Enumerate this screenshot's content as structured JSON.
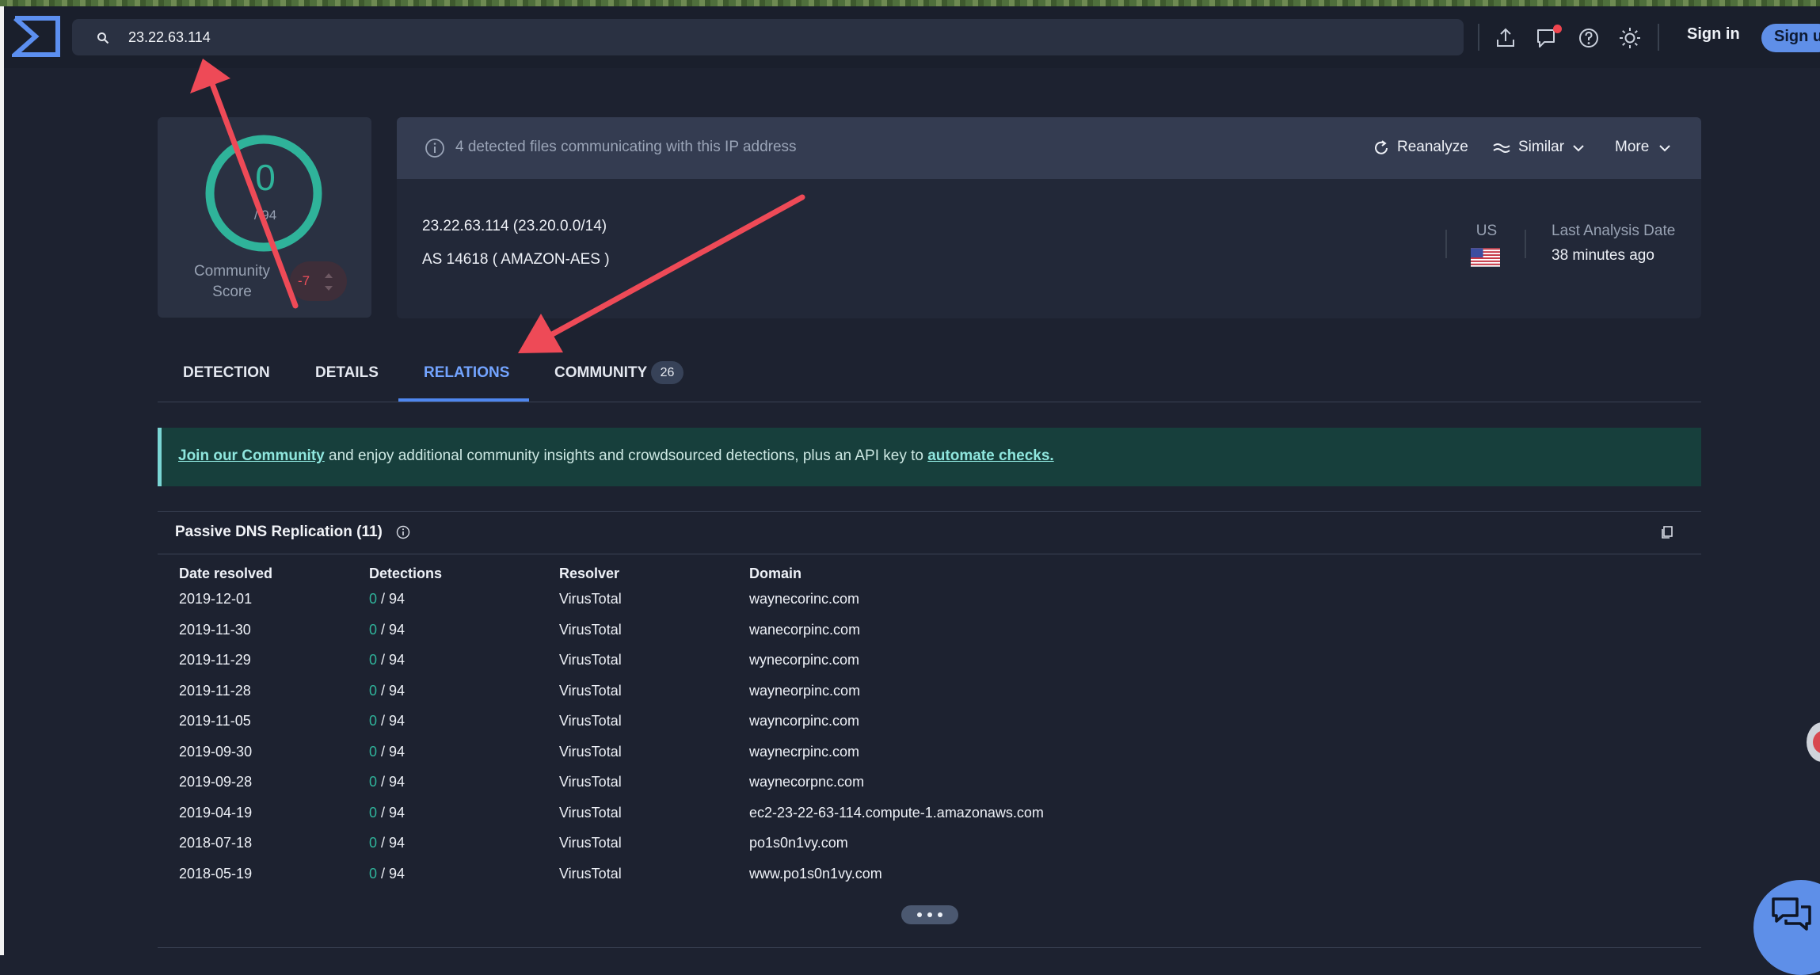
{
  "search": {
    "query": "23.22.63.114"
  },
  "header": {
    "sign_in": "Sign in",
    "sign_up": "Sign up"
  },
  "score": {
    "detections": "0",
    "total": "/ 94",
    "label": "Community Score",
    "community_vote": "-7"
  },
  "info": {
    "banner_text": "4 detected files communicating with this IP address",
    "reanalyze": "Reanalyze",
    "similar": "Similar",
    "more": "More",
    "ip_line": "23.22.63.114  (23.20.0.0/14)",
    "as_line": "AS 14618  ( AMAZON-AES )",
    "country": "US",
    "last_analysis_label": "Last Analysis Date",
    "last_analysis_value": "38 minutes ago"
  },
  "tabs": [
    {
      "label": "DETECTION"
    },
    {
      "label": "DETAILS"
    },
    {
      "label": "RELATIONS",
      "active": true
    },
    {
      "label": "COMMUNITY",
      "badge": "26"
    }
  ],
  "banner": {
    "link1": "Join our Community",
    "middle": " and enjoy additional community insights and crowdsourced detections, plus an API key to ",
    "link2": "automate checks."
  },
  "dns": {
    "title": "Passive DNS Replication  (11)",
    "columns": [
      "Date resolved",
      "Detections",
      "Resolver",
      "Domain"
    ],
    "rows": [
      {
        "date": "2019-12-01",
        "det": "0",
        "total": "/ 94",
        "resolver": "VirusTotal",
        "domain": "waynecorinc.com"
      },
      {
        "date": "2019-11-30",
        "det": "0",
        "total": "/ 94",
        "resolver": "VirusTotal",
        "domain": "wanecorpinc.com"
      },
      {
        "date": "2019-11-29",
        "det": "0",
        "total": "/ 94",
        "resolver": "VirusTotal",
        "domain": "wynecorpinc.com"
      },
      {
        "date": "2019-11-28",
        "det": "0",
        "total": "/ 94",
        "resolver": "VirusTotal",
        "domain": "wayneorpinc.com"
      },
      {
        "date": "2019-11-05",
        "det": "0",
        "total": "/ 94",
        "resolver": "VirusTotal",
        "domain": "wayncorpinc.com"
      },
      {
        "date": "2019-09-30",
        "det": "0",
        "total": "/ 94",
        "resolver": "VirusTotal",
        "domain": "waynecrpinc.com"
      },
      {
        "date": "2019-09-28",
        "det": "0",
        "total": "/ 94",
        "resolver": "VirusTotal",
        "domain": "waynecorpnc.com"
      },
      {
        "date": "2019-04-19",
        "det": "0",
        "total": "/ 94",
        "resolver": "VirusTotal",
        "domain": "ec2-23-22-63-114.compute-1.amazonaws.com"
      },
      {
        "date": "2018-07-18",
        "det": "0",
        "total": "/ 94",
        "resolver": "VirusTotal",
        "domain": "po1s0n1vy.com"
      },
      {
        "date": "2018-05-19",
        "det": "0",
        "total": "/ 94",
        "resolver": "VirusTotal",
        "domain": "www.po1s0n1vy.com"
      }
    ]
  },
  "icons": {
    "logo": "virustotal-logo",
    "search": "search-icon",
    "upload": "upload-icon",
    "chat": "chat-icon",
    "help": "help-icon",
    "theme": "sun-icon",
    "info": "info-icon",
    "reanalyze": "refresh-icon",
    "similar": "similar-icon",
    "more": "chevron-down-icon",
    "copy": "copy-icon",
    "flag": "us-flag-icon"
  },
  "colors": {
    "accent": "#4f87ef",
    "detection_ok": "#2fb39a",
    "vote_negative": "#ee4f5a",
    "banner_bg": "#173f3c",
    "annotation": "#ee4a57"
  }
}
